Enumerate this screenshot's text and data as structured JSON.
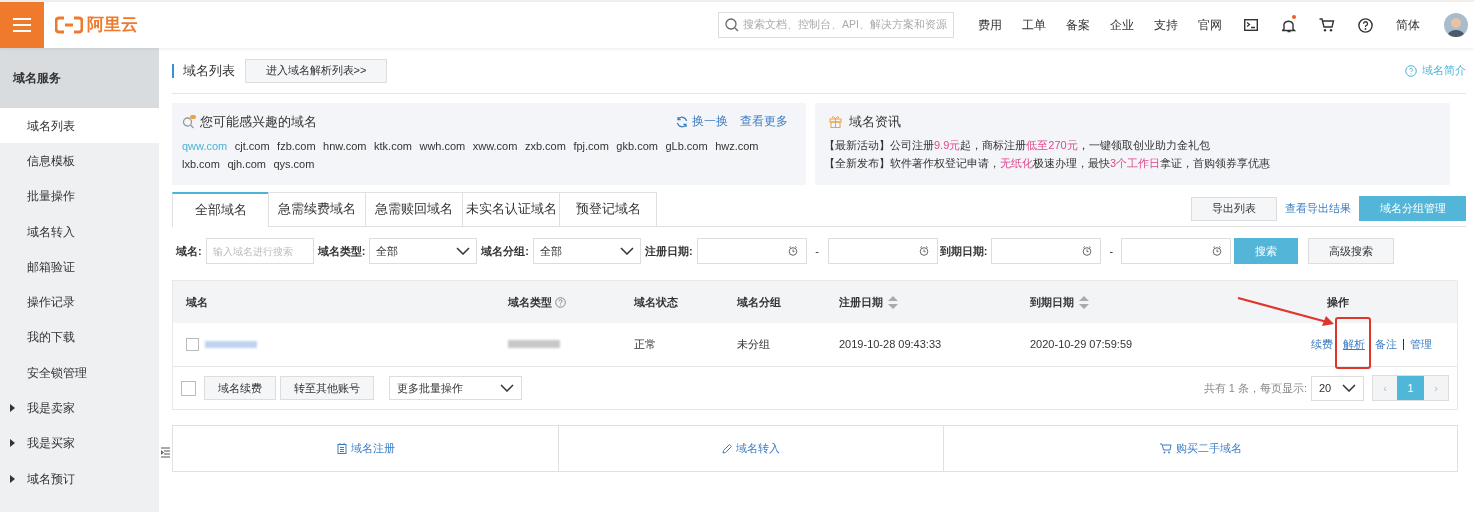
{
  "header": {
    "logo": "阿里云",
    "search": {
      "placeholder": "搜索文档、控制台、API、解决方案和资源"
    },
    "nav": [
      "费用",
      "工单",
      "备案",
      "企业",
      "支持",
      "官网"
    ],
    "icons": [
      {
        "kind": "terminal"
      },
      {
        "kind": "bell",
        "badge": true
      },
      {
        "kind": "cart"
      },
      {
        "kind": "help"
      }
    ],
    "language": "简体"
  },
  "sidebar": {
    "title": "域名服务",
    "items": [
      {
        "label": "域名列表",
        "selected": true,
        "expandable": false
      },
      {
        "label": "信息模板",
        "selected": false,
        "expandable": false
      },
      {
        "label": "批量操作",
        "selected": false,
        "expandable": false
      },
      {
        "label": "域名转入",
        "selected": false,
        "expandable": false
      },
      {
        "label": "邮箱验证",
        "selected": false,
        "expandable": false
      },
      {
        "label": "操作记录",
        "selected": false,
        "expandable": false
      },
      {
        "label": "我的下载",
        "selected": false,
        "expandable": false
      },
      {
        "label": "安全锁管理",
        "selected": false,
        "expandable": false
      },
      {
        "label": "我是卖家",
        "selected": false,
        "expandable": true
      },
      {
        "label": "我是买家",
        "selected": false,
        "expandable": true
      },
      {
        "label": "域名预订",
        "selected": false,
        "expandable": true
      }
    ]
  },
  "page": {
    "title": "域名列表",
    "enter_button": "进入域名解析列表>>",
    "help_link": "域名简介"
  },
  "suggest": {
    "title": "您可能感兴趣的域名",
    "refresh": "换一换",
    "more": "查看更多",
    "domains": [
      {
        "text": "qww.com",
        "selected": true
      },
      {
        "text": "cjt.com",
        "selected": false
      },
      {
        "text": "fzb.com",
        "selected": false
      },
      {
        "text": "hnw.com",
        "selected": false
      },
      {
        "text": "ktk.com",
        "selected": false
      },
      {
        "text": "wwh.com",
        "selected": false
      },
      {
        "text": "xww.com",
        "selected": false
      },
      {
        "text": "zxb.com",
        "selected": false
      },
      {
        "text": "fpj.com",
        "selected": false
      },
      {
        "text": "gkb.com",
        "selected": false
      },
      {
        "text": "gLb.com",
        "selected": false
      },
      {
        "text": "hwz.com",
        "selected": false
      },
      {
        "text": "lxb.com",
        "selected": false
      },
      {
        "text": "qjh.com",
        "selected": false
      },
      {
        "text": "qys.com",
        "selected": false
      }
    ]
  },
  "news": {
    "title": "域名资讯",
    "lines": [
      [
        {
          "text": "【最新活动】公司注册",
          "highlight": false
        },
        {
          "text": "9.9元",
          "highlight": true
        },
        {
          "text": "起，商标注册",
          "highlight": false
        },
        {
          "text": "低至270元",
          "highlight": true
        },
        {
          "text": "，一键领取创业助力金礼包",
          "highlight": false
        }
      ],
      [
        {
          "text": "【全新发布】软件著作权登记申请，",
          "highlight": false
        },
        {
          "text": "无纸化",
          "highlight": true
        },
        {
          "text": "极速办理，最快",
          "highlight": false
        },
        {
          "text": "3个工作日",
          "highlight": true
        },
        {
          "text": "拿证，首购领券享优惠",
          "highlight": false
        }
      ]
    ]
  },
  "tabs": [
    {
      "label": "全部域名",
      "selected": true
    },
    {
      "label": "急需续费域名",
      "selected": false
    },
    {
      "label": "急需赎回域名",
      "selected": false
    },
    {
      "label": "未实名认证域名",
      "selected": false
    },
    {
      "label": "预登记域名",
      "selected": false
    }
  ],
  "actions": {
    "export": "导出列表",
    "export_results": "查看导出结果",
    "group_manage": "域名分组管理"
  },
  "filters": {
    "name_label": "域名:",
    "name_placeholder": "输入域名进行搜索",
    "type_label": "域名类型:",
    "type_value": "全部",
    "group_label": "域名分组:",
    "group_value": "全部",
    "reg_label": "注册日期:",
    "exp_label": "到期日期:",
    "dash": "-",
    "search": "搜索",
    "advanced": "高级搜索"
  },
  "table": {
    "columns": [
      {
        "label": "域名",
        "help": false,
        "sortable": false
      },
      {
        "label": "域名类型",
        "help": true,
        "sortable": false
      },
      {
        "label": "域名状态",
        "help": false,
        "sortable": false
      },
      {
        "label": "域名分组",
        "help": false,
        "sortable": false
      },
      {
        "label": "注册日期",
        "help": false,
        "sortable": true
      },
      {
        "label": "到期日期",
        "help": false,
        "sortable": true
      },
      {
        "label": "操作",
        "help": false,
        "sortable": false
      }
    ],
    "rows": [
      {
        "checked": false,
        "status": "正常",
        "group": "未分组",
        "registered": "2019-10-28 09:43:33",
        "expires": "2020-10-29 07:59:59",
        "actions": [
          {
            "label": "续费",
            "highlighted": false
          },
          {
            "label": "解析",
            "highlighted": true
          },
          {
            "label": "备注",
            "highlighted": false
          },
          {
            "label": "管理",
            "highlighted": false
          }
        ]
      }
    ]
  },
  "batch": {
    "checked": false,
    "buttons": [
      "域名续费",
      "转至其他账号"
    ],
    "more": "更多批量操作"
  },
  "pagination": {
    "summary": "共有 1 条，每页显示:",
    "page_size": "20",
    "prev": "‹",
    "pages": [
      {
        "label": "1",
        "selected": true
      }
    ],
    "next": "›"
  },
  "bottom_links": [
    {
      "kind": "calendar",
      "label": "域名注册"
    },
    {
      "kind": "pencil",
      "label": "域名转入"
    },
    {
      "kind": "cart",
      "label": "购买二手域名"
    }
  ]
}
